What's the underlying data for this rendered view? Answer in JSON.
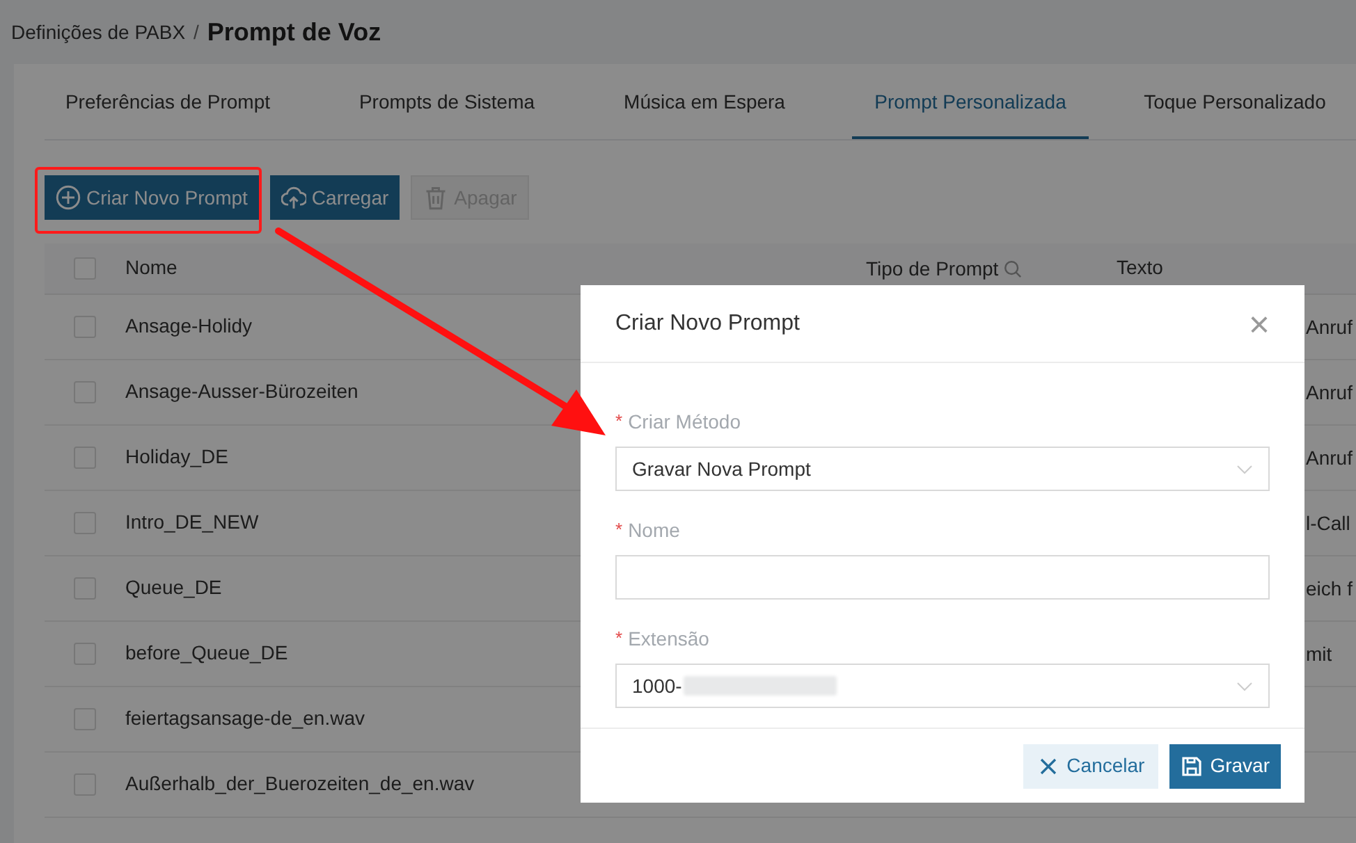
{
  "breadcrumb": {
    "parent": "Definições de PABX",
    "separator": "/",
    "current": "Prompt de Voz"
  },
  "tabs": [
    {
      "label": "Preferências de Prompt",
      "selected": false
    },
    {
      "label": "Prompts de Sistema",
      "selected": false
    },
    {
      "label": "Música em Espera",
      "selected": false
    },
    {
      "label": "Prompt Personalizada",
      "selected": true
    },
    {
      "label": "Toque Personalizado",
      "selected": false
    }
  ],
  "toolbar": [
    {
      "label": "Criar Novo Prompt",
      "kind": "create",
      "disabled": false,
      "highlighted": true
    },
    {
      "label": "Carregar",
      "kind": "upload",
      "disabled": false,
      "highlighted": false
    },
    {
      "label": "Apagar",
      "kind": "delete",
      "disabled": true,
      "highlighted": false
    }
  ],
  "table": {
    "columns": [
      "Nome",
      "Tipo de Prompt",
      "Texto"
    ],
    "header_checked": false,
    "rows": [
      {
        "name": "Ansage-Holidy",
        "text": "Anruf",
        "checked": false
      },
      {
        "name": "Ansage-Ausser-Bürozeiten",
        "text": "Anruf",
        "checked": false
      },
      {
        "name": "Holiday_DE",
        "text": "Anruf",
        "checked": false
      },
      {
        "name": "Intro_DE_NEW",
        "text": "l-Call",
        "checked": false
      },
      {
        "name": "Queue_DE",
        "text": "eich f",
        "checked": false
      },
      {
        "name": "before_Queue_DE",
        "text": "mit",
        "checked": false
      },
      {
        "name": "feiertagsansage-de_en.wav",
        "checked": false
      },
      {
        "name": "Außerhalb_der_Buerozeiten_de_en.wav",
        "checked": false
      }
    ]
  },
  "dialog": {
    "title": "Criar Novo Prompt",
    "close": "×",
    "fields": [
      {
        "label": "Criar Método",
        "required_mark": "*",
        "kind": "select",
        "value": "Gravar Nova Prompt"
      },
      {
        "label": "Nome",
        "required_mark": "*",
        "kind": "input"
      },
      {
        "label": "Extensão",
        "required_mark": "*",
        "kind": "select",
        "value": "1000-",
        "redacted": true
      }
    ],
    "buttons": [
      {
        "label": "Cancelar",
        "kind": "cancel"
      },
      {
        "label": "Gravar",
        "kind": "save"
      }
    ]
  }
}
